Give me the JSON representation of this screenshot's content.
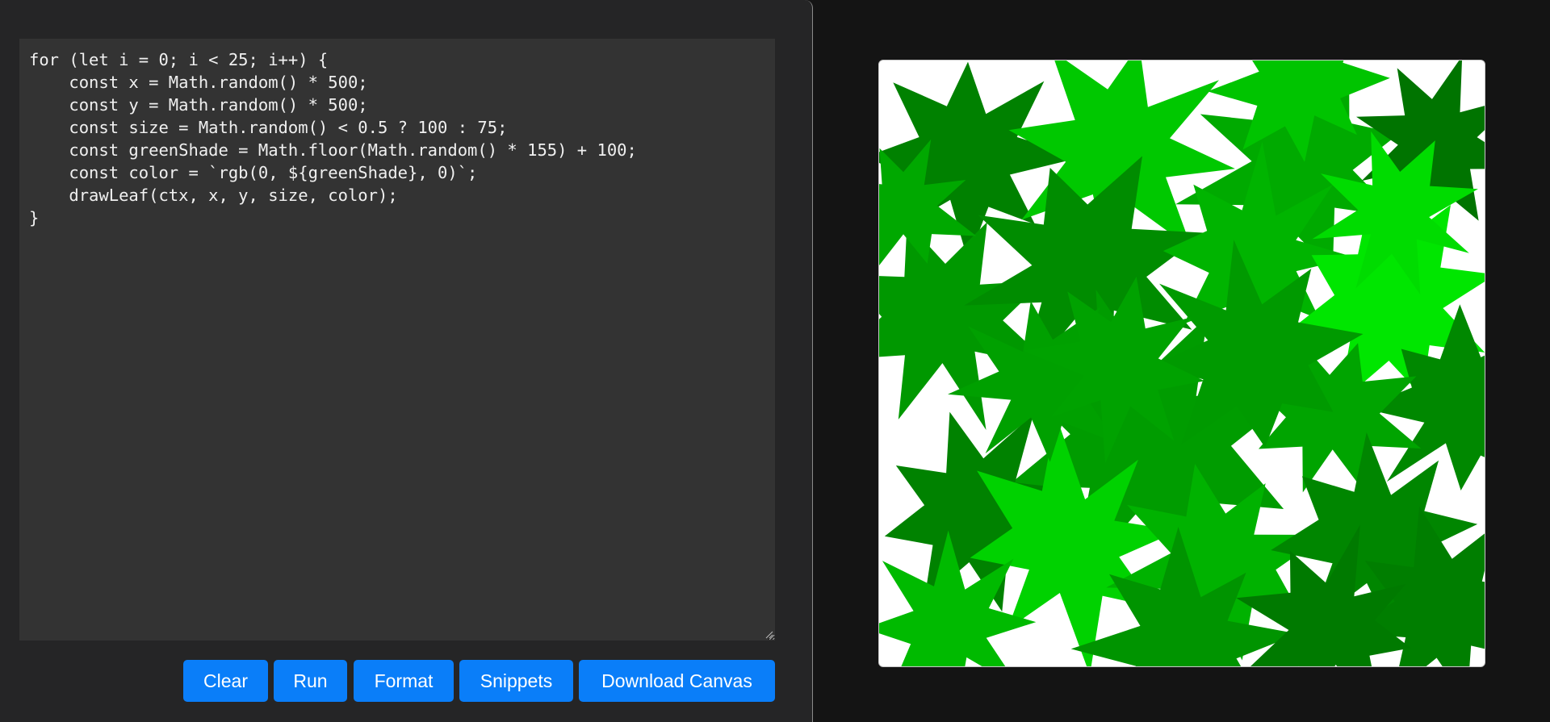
{
  "editor": {
    "code": "for (let i = 0; i < 25; i++) {\n    const x = Math.random() * 500;\n    const y = Math.random() * 500;\n    const size = Math.random() < 0.5 ? 100 : 75;\n    const greenShade = Math.floor(Math.random() * 155) + 100;\n    const color = `rgb(0, ${greenShade}, 0)`;\n    drawLeaf(ctx, x, y, size, color);\n}"
  },
  "toolbar": {
    "clear_label": "Clear",
    "run_label": "Run",
    "format_label": "Format",
    "snippets_label": "Snippets",
    "download_label": "Download Canvas"
  },
  "colors": {
    "button": "#0a7ef9",
    "editor_bg": "#333333",
    "panel_bg": "#252526",
    "page_bg": "#141414"
  },
  "canvas": {
    "leaf_count": 25,
    "leaf_color_rule": "rgb(0, 100–255, 0)"
  }
}
